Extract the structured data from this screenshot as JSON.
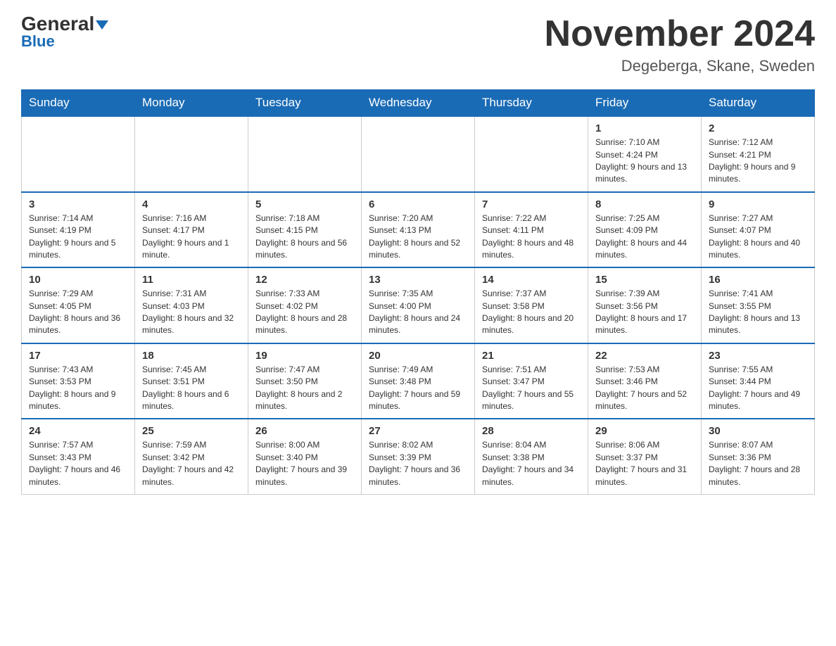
{
  "header": {
    "logo_general": "General",
    "logo_blue": "Blue",
    "month_title": "November 2024",
    "location": "Degeberga, Skane, Sweden"
  },
  "days_of_week": [
    "Sunday",
    "Monday",
    "Tuesday",
    "Wednesday",
    "Thursday",
    "Friday",
    "Saturday"
  ],
  "weeks": [
    [
      {
        "day": "",
        "info": ""
      },
      {
        "day": "",
        "info": ""
      },
      {
        "day": "",
        "info": ""
      },
      {
        "day": "",
        "info": ""
      },
      {
        "day": "",
        "info": ""
      },
      {
        "day": "1",
        "info": "Sunrise: 7:10 AM\nSunset: 4:24 PM\nDaylight: 9 hours and 13 minutes."
      },
      {
        "day": "2",
        "info": "Sunrise: 7:12 AM\nSunset: 4:21 PM\nDaylight: 9 hours and 9 minutes."
      }
    ],
    [
      {
        "day": "3",
        "info": "Sunrise: 7:14 AM\nSunset: 4:19 PM\nDaylight: 9 hours and 5 minutes."
      },
      {
        "day": "4",
        "info": "Sunrise: 7:16 AM\nSunset: 4:17 PM\nDaylight: 9 hours and 1 minute."
      },
      {
        "day": "5",
        "info": "Sunrise: 7:18 AM\nSunset: 4:15 PM\nDaylight: 8 hours and 56 minutes."
      },
      {
        "day": "6",
        "info": "Sunrise: 7:20 AM\nSunset: 4:13 PM\nDaylight: 8 hours and 52 minutes."
      },
      {
        "day": "7",
        "info": "Sunrise: 7:22 AM\nSunset: 4:11 PM\nDaylight: 8 hours and 48 minutes."
      },
      {
        "day": "8",
        "info": "Sunrise: 7:25 AM\nSunset: 4:09 PM\nDaylight: 8 hours and 44 minutes."
      },
      {
        "day": "9",
        "info": "Sunrise: 7:27 AM\nSunset: 4:07 PM\nDaylight: 8 hours and 40 minutes."
      }
    ],
    [
      {
        "day": "10",
        "info": "Sunrise: 7:29 AM\nSunset: 4:05 PM\nDaylight: 8 hours and 36 minutes."
      },
      {
        "day": "11",
        "info": "Sunrise: 7:31 AM\nSunset: 4:03 PM\nDaylight: 8 hours and 32 minutes."
      },
      {
        "day": "12",
        "info": "Sunrise: 7:33 AM\nSunset: 4:02 PM\nDaylight: 8 hours and 28 minutes."
      },
      {
        "day": "13",
        "info": "Sunrise: 7:35 AM\nSunset: 4:00 PM\nDaylight: 8 hours and 24 minutes."
      },
      {
        "day": "14",
        "info": "Sunrise: 7:37 AM\nSunset: 3:58 PM\nDaylight: 8 hours and 20 minutes."
      },
      {
        "day": "15",
        "info": "Sunrise: 7:39 AM\nSunset: 3:56 PM\nDaylight: 8 hours and 17 minutes."
      },
      {
        "day": "16",
        "info": "Sunrise: 7:41 AM\nSunset: 3:55 PM\nDaylight: 8 hours and 13 minutes."
      }
    ],
    [
      {
        "day": "17",
        "info": "Sunrise: 7:43 AM\nSunset: 3:53 PM\nDaylight: 8 hours and 9 minutes."
      },
      {
        "day": "18",
        "info": "Sunrise: 7:45 AM\nSunset: 3:51 PM\nDaylight: 8 hours and 6 minutes."
      },
      {
        "day": "19",
        "info": "Sunrise: 7:47 AM\nSunset: 3:50 PM\nDaylight: 8 hours and 2 minutes."
      },
      {
        "day": "20",
        "info": "Sunrise: 7:49 AM\nSunset: 3:48 PM\nDaylight: 7 hours and 59 minutes."
      },
      {
        "day": "21",
        "info": "Sunrise: 7:51 AM\nSunset: 3:47 PM\nDaylight: 7 hours and 55 minutes."
      },
      {
        "day": "22",
        "info": "Sunrise: 7:53 AM\nSunset: 3:46 PM\nDaylight: 7 hours and 52 minutes."
      },
      {
        "day": "23",
        "info": "Sunrise: 7:55 AM\nSunset: 3:44 PM\nDaylight: 7 hours and 49 minutes."
      }
    ],
    [
      {
        "day": "24",
        "info": "Sunrise: 7:57 AM\nSunset: 3:43 PM\nDaylight: 7 hours and 46 minutes."
      },
      {
        "day": "25",
        "info": "Sunrise: 7:59 AM\nSunset: 3:42 PM\nDaylight: 7 hours and 42 minutes."
      },
      {
        "day": "26",
        "info": "Sunrise: 8:00 AM\nSunset: 3:40 PM\nDaylight: 7 hours and 39 minutes."
      },
      {
        "day": "27",
        "info": "Sunrise: 8:02 AM\nSunset: 3:39 PM\nDaylight: 7 hours and 36 minutes."
      },
      {
        "day": "28",
        "info": "Sunrise: 8:04 AM\nSunset: 3:38 PM\nDaylight: 7 hours and 34 minutes."
      },
      {
        "day": "29",
        "info": "Sunrise: 8:06 AM\nSunset: 3:37 PM\nDaylight: 7 hours and 31 minutes."
      },
      {
        "day": "30",
        "info": "Sunrise: 8:07 AM\nSunset: 3:36 PM\nDaylight: 7 hours and 28 minutes."
      }
    ]
  ]
}
